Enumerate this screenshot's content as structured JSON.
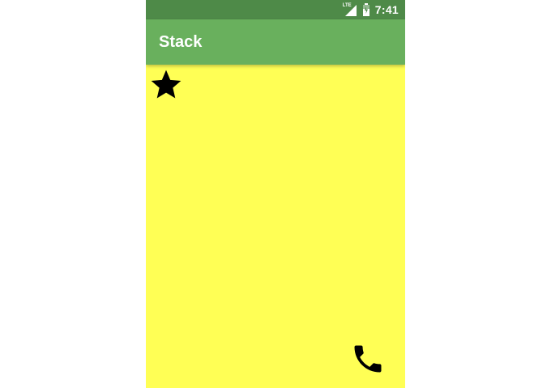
{
  "status_bar": {
    "network_label": "LTE",
    "time": "7:41",
    "icons": [
      "lte-signal-icon",
      "battery-icon"
    ]
  },
  "app_bar": {
    "title": "Stack"
  },
  "stack": {
    "background_color": "#ffff55",
    "children": [
      {
        "icon": "star-icon",
        "color": "#000000",
        "alignment": "top-left"
      },
      {
        "icon": "phone-icon",
        "color": "#000000",
        "alignment": "bottom-right"
      }
    ]
  },
  "colors": {
    "status_bar": "#4e8a48",
    "app_bar": "#69b05d",
    "title_text": "#ffffff"
  }
}
